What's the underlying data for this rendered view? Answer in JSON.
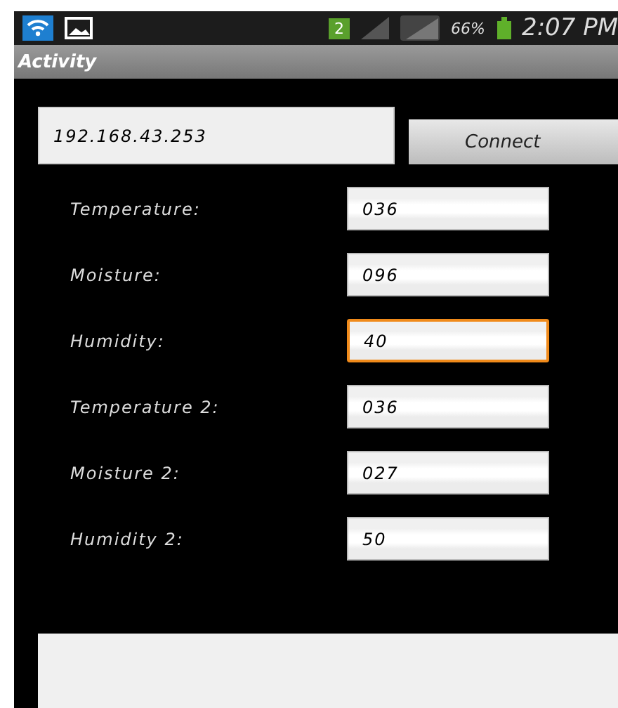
{
  "status_bar": {
    "notification_count": "2",
    "battery_percent": "66%",
    "time": "2:07 PM"
  },
  "action_bar": {
    "title": "Activity"
  },
  "address_field": {
    "value": "192.168.43.253"
  },
  "connect_button": {
    "label": "Connect"
  },
  "readings": [
    {
      "label": "Temperature:",
      "value": "036",
      "focused": false
    },
    {
      "label": "Moisture:",
      "value": "096",
      "focused": false
    },
    {
      "label": "Humidity:",
      "value": "40",
      "focused": true
    },
    {
      "label": "Temperature 2:",
      "value": "036",
      "focused": false
    },
    {
      "label": "Moisture 2:",
      "value": "027",
      "focused": false
    },
    {
      "label": "Humidity 2:",
      "value": "50",
      "focused": false
    }
  ]
}
